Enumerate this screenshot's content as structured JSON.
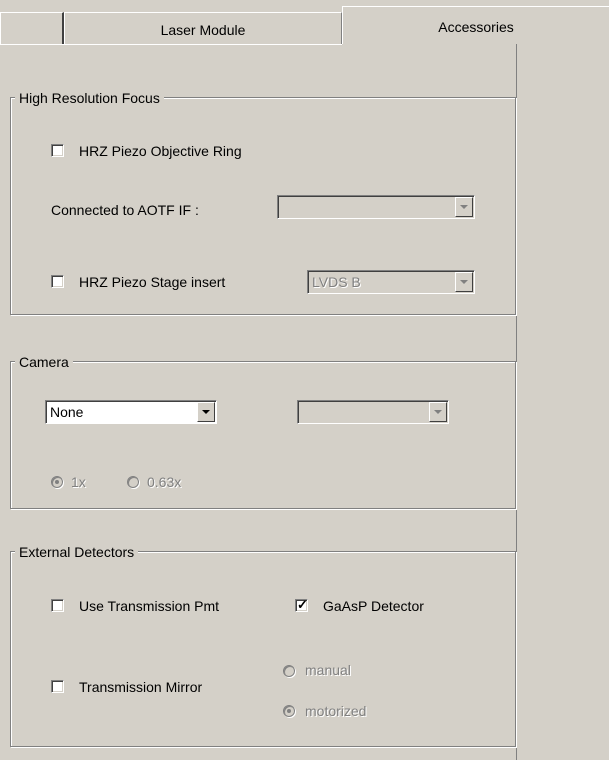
{
  "tabs": [
    {
      "label": ""
    },
    {
      "label": "Laser Module"
    },
    {
      "label": "Accessories",
      "selected": true
    }
  ],
  "hrf": {
    "title": "High Resolution Focus",
    "objective_ring": {
      "label": "HRZ Piezo Objective Ring",
      "checked": false
    },
    "connected_label": "Connected to AOTF IF :",
    "connected_value": "",
    "stage_insert": {
      "label": "HRZ Piezo Stage insert",
      "checked": false
    },
    "stage_value": "LVDS B"
  },
  "camera": {
    "title": "Camera",
    "select_value": "None",
    "second_select_value": "",
    "mag_1x": {
      "label": "1x",
      "selected": true
    },
    "mag_063x": {
      "label": "0.63x",
      "selected": false
    }
  },
  "ext": {
    "title": "External Detectors",
    "transmission_pmt": {
      "label": "Use Transmission Pmt",
      "checked": false
    },
    "gaasp": {
      "label": "GaAsP Detector",
      "checked": true
    },
    "transmission_mirror": {
      "label": "Transmission Mirror",
      "checked": false
    },
    "manual": {
      "label": "manual",
      "selected": false
    },
    "motorized": {
      "label": "motorized",
      "selected": true
    }
  },
  "colors": {
    "window_bg": "#d4d0c8",
    "shadow": "#808080",
    "highlight": "#ffffff"
  },
  "icons": {
    "dropdown": "chevron-down-icon",
    "check": "checkmark-icon"
  }
}
